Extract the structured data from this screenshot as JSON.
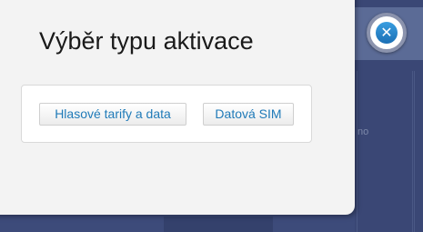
{
  "background": {
    "fragment_text": "no"
  },
  "dialog": {
    "title": "Výběr typu aktivace",
    "options": [
      {
        "label": "Hlasové tarify a data"
      },
      {
        "label": "Datová SIM"
      }
    ],
    "close_icon": "close-icon"
  },
  "colors": {
    "link_blue": "#1f7ab8",
    "close_blue": "#2a86cf",
    "overlay": "#3d4b7a"
  }
}
